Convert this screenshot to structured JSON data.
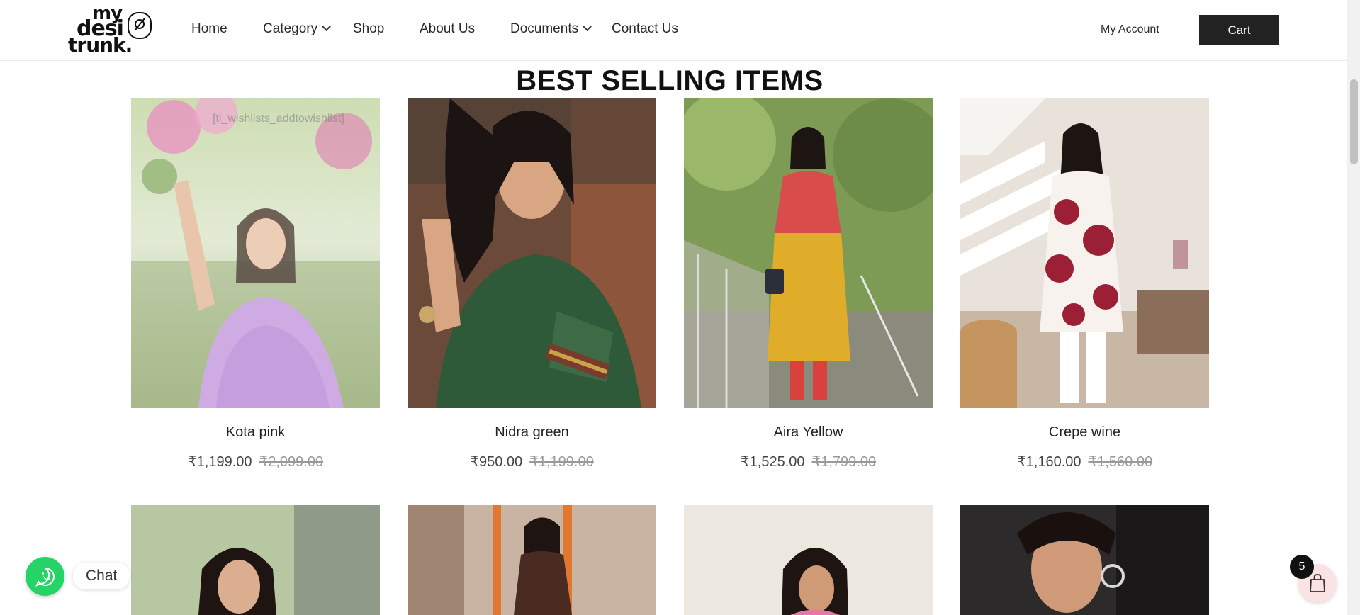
{
  "header": {
    "logo": {
      "line1": "my",
      "line2": "desi",
      "line3": "trunk."
    },
    "nav": [
      {
        "label": "Home",
        "has_dropdown": false
      },
      {
        "label": "Category",
        "has_dropdown": true
      },
      {
        "label": "Shop",
        "has_dropdown": false
      },
      {
        "label": "About Us",
        "has_dropdown": false
      },
      {
        "label": "Documents",
        "has_dropdown": true
      },
      {
        "label": "Contact Us",
        "has_dropdown": false
      }
    ],
    "account_label": "My Account",
    "cart_label": "Cart"
  },
  "section": {
    "title": "BEST SELLING ITEMS"
  },
  "products": [
    {
      "name": "Kota pink",
      "price": "₹1,199.00",
      "old_price": "₹2,099.00"
    },
    {
      "name": "Nidra green",
      "price": "₹950.00",
      "old_price": "₹1,199.00"
    },
    {
      "name": "Aira Yellow",
      "price": "₹1,525.00",
      "old_price": "₹1,799.00"
    },
    {
      "name": "Crepe wine",
      "price": "₹1,160.00",
      "old_price": "₹1,560.00"
    }
  ],
  "wishlist_overlay_text": "[ti_wishlists_addtowishlist]",
  "chat": {
    "label": "Chat",
    "icon": "whatsapp-icon"
  },
  "floating_cart": {
    "count": "5",
    "icon": "shopping-bag-icon"
  },
  "colors": {
    "accent": "#222222",
    "chat": "#25d366",
    "muted": "#999999"
  }
}
